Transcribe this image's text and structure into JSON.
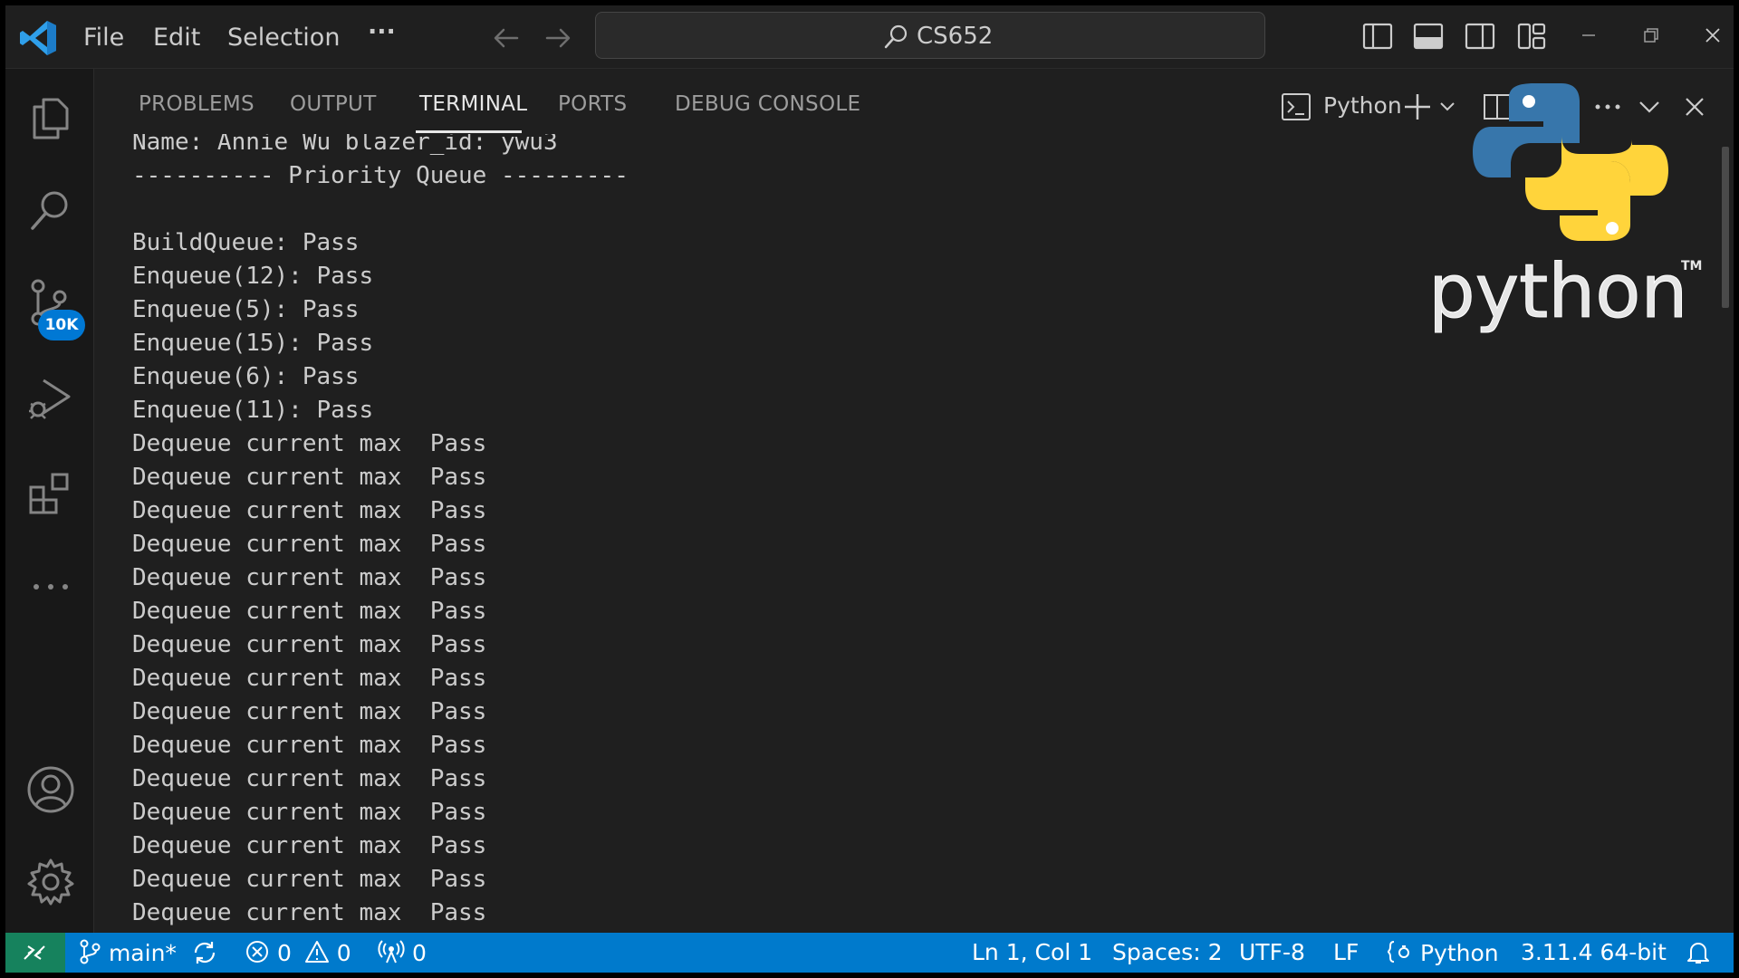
{
  "menu": {
    "file": "File",
    "edit": "Edit",
    "selection": "Selection",
    "more": "···"
  },
  "search": {
    "text": "CS652"
  },
  "activity": {
    "source_control_badge": "10K"
  },
  "panel": {
    "tabs": [
      "PROBLEMS",
      "OUTPUT",
      "TERMINAL",
      "PORTS",
      "DEBUG CONSOLE"
    ],
    "active_tab": "TERMINAL",
    "terminal_profile": "Python"
  },
  "terminal": {
    "lines": [
      "Name: Annie Wu blazer_id: ywu3",
      "---------- Priority Queue ---------",
      "",
      "BuildQueue: Pass",
      "Enqueue(12): Pass",
      "Enqueue(5): Pass",
      "Enqueue(15): Pass",
      "Enqueue(6): Pass",
      "Enqueue(11): Pass",
      "Dequeue current max  Pass",
      "Dequeue current max  Pass",
      "Dequeue current max  Pass",
      "Dequeue current max  Pass",
      "Dequeue current max  Pass",
      "Dequeue current max  Pass",
      "Dequeue current max  Pass",
      "Dequeue current max  Pass",
      "Dequeue current max  Pass",
      "Dequeue current max  Pass",
      "Dequeue current max  Pass",
      "Dequeue current max  Pass",
      "Dequeue current max  Pass",
      "Dequeue current max  Pass",
      "Dequeue current max  Pass"
    ]
  },
  "overlay_logo": {
    "wordmark": "python",
    "tm": "TM"
  },
  "statusbar": {
    "branch": "main*",
    "errors": "0",
    "warnings": "0",
    "ports": "0",
    "position": "Ln 1, Col 1",
    "spaces": "Spaces: 2",
    "encoding": "UTF-8",
    "eol": "LF",
    "language": "Python",
    "interpreter": "3.11.4 64-bit"
  },
  "colors": {
    "accent": "#007acc",
    "remote": "#16825d",
    "badge": "#0078d4",
    "python_blue": "#3776ab",
    "python_yellow": "#ffd43b"
  }
}
